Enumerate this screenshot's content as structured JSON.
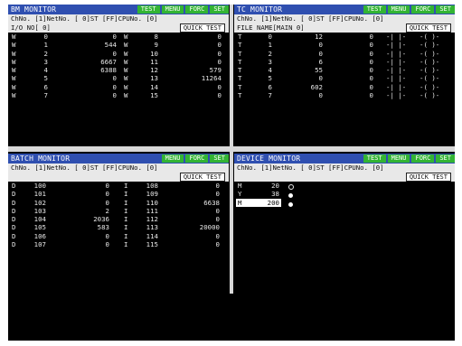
{
  "buttons": {
    "test": "TEST",
    "menu": "MENU",
    "forc": "FORC",
    "set": "SET",
    "quick": "QUICK TEST"
  },
  "bm": {
    "title": "BM MONITOR",
    "line1": "ChNo. [1]NetNo. [  0]ST   [FF]CPUNo. [0]",
    "line2": "I/O NO[  0]",
    "rows": [
      [
        "W",
        "0",
        "0",
        "W",
        "8",
        "0"
      ],
      [
        "W",
        "1",
        "544",
        "W",
        "9",
        "0"
      ],
      [
        "W",
        "2",
        "0",
        "W",
        "10",
        "0"
      ],
      [
        "W",
        "3",
        "6667",
        "W",
        "11",
        "0"
      ],
      [
        "W",
        "4",
        "6388",
        "W",
        "12",
        "579"
      ],
      [
        "W",
        "5",
        "0",
        "W",
        "13",
        "11264"
      ],
      [
        "W",
        "6",
        "0",
        "W",
        "14",
        "0"
      ],
      [
        "W",
        "7",
        "0",
        "W",
        "15",
        "0"
      ]
    ]
  },
  "tc": {
    "title": "TC MONITOR",
    "line1": "ChNo. [1]NetNo. [  0]ST   [FF]CPUNo. [0]",
    "line2": "FILE NAME[MAIN       0]",
    "rows": [
      [
        "T",
        "0",
        "12",
        "0"
      ],
      [
        "T",
        "1",
        "0",
        "0"
      ],
      [
        "T",
        "2",
        "0",
        "0"
      ],
      [
        "T",
        "3",
        "6",
        "0"
      ],
      [
        "T",
        "4",
        "55",
        "0"
      ],
      [
        "T",
        "5",
        "0",
        "0"
      ],
      [
        "T",
        "6",
        "602",
        "0"
      ],
      [
        "T",
        "7",
        "0",
        "0"
      ]
    ]
  },
  "batch": {
    "title": "BATCH MONITOR",
    "line1": "ChNo. [1]NetNo. [  0]ST   [FF]CPUNo. [0]",
    "rows": [
      [
        "D",
        "100",
        "0",
        "I",
        "108",
        "0"
      ],
      [
        "D",
        "101",
        "0",
        "I",
        "109",
        "0"
      ],
      [
        "D",
        "102",
        "0",
        "I",
        "110",
        "6638"
      ],
      [
        "D",
        "103",
        "2",
        "I",
        "111",
        "0"
      ],
      [
        "D",
        "104",
        "2036",
        "I",
        "112",
        "0"
      ],
      [
        "D",
        "105",
        "583",
        "I",
        "113",
        "20000"
      ],
      [
        "D",
        "106",
        "0",
        "I",
        "114",
        "0"
      ],
      [
        "D",
        "107",
        "0",
        "I",
        "115",
        "0"
      ]
    ]
  },
  "device": {
    "title": "DEVICE MONITOR",
    "line1": "ChNo. [1]NetNo. [  0]ST   [FF]CPUNo. [0]",
    "rows": [
      {
        "dev": "M",
        "num": "20",
        "state": "off"
      },
      {
        "dev": "Y",
        "num": "38",
        "state": "on"
      },
      {
        "dev": "M",
        "num": "200",
        "state": "on"
      }
    ]
  },
  "colors": {
    "title_bar": "#2f4fb0",
    "button": "#33b433",
    "header": "#e8e8e8",
    "screen": "#000000"
  }
}
